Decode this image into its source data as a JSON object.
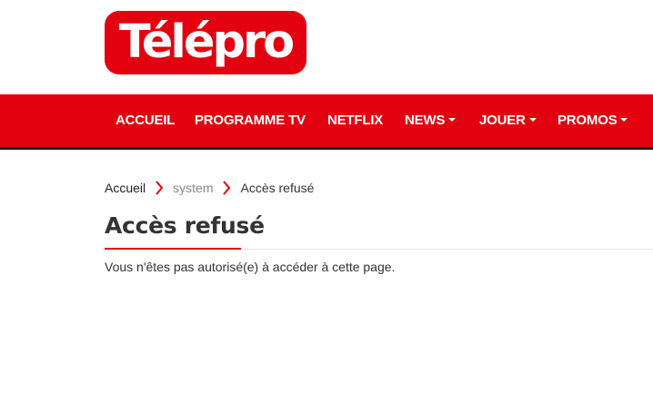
{
  "logo": {
    "text": "Télépro"
  },
  "nav": {
    "items": [
      {
        "label": "ACCUEIL",
        "has_dropdown": false
      },
      {
        "label": "PROGRAMME TV",
        "has_dropdown": false
      },
      {
        "label": "NETFLIX",
        "has_dropdown": false
      },
      {
        "label": "NEWS",
        "has_dropdown": true
      },
      {
        "label": "JOUER",
        "has_dropdown": true
      },
      {
        "label": "PROMOS",
        "has_dropdown": true
      }
    ]
  },
  "breadcrumb": {
    "items": [
      {
        "label": "Accueil"
      },
      {
        "label": "system"
      },
      {
        "label": "Accès refusé"
      }
    ]
  },
  "page": {
    "title": "Accès refusé",
    "message": "Vous n'êtes pas autorisé(e) à accéder à cette page."
  },
  "colors": {
    "brand_red": "#e3000f",
    "nav_border": "#1c1c1c",
    "breadcrumb_separator": "#e3000f"
  }
}
